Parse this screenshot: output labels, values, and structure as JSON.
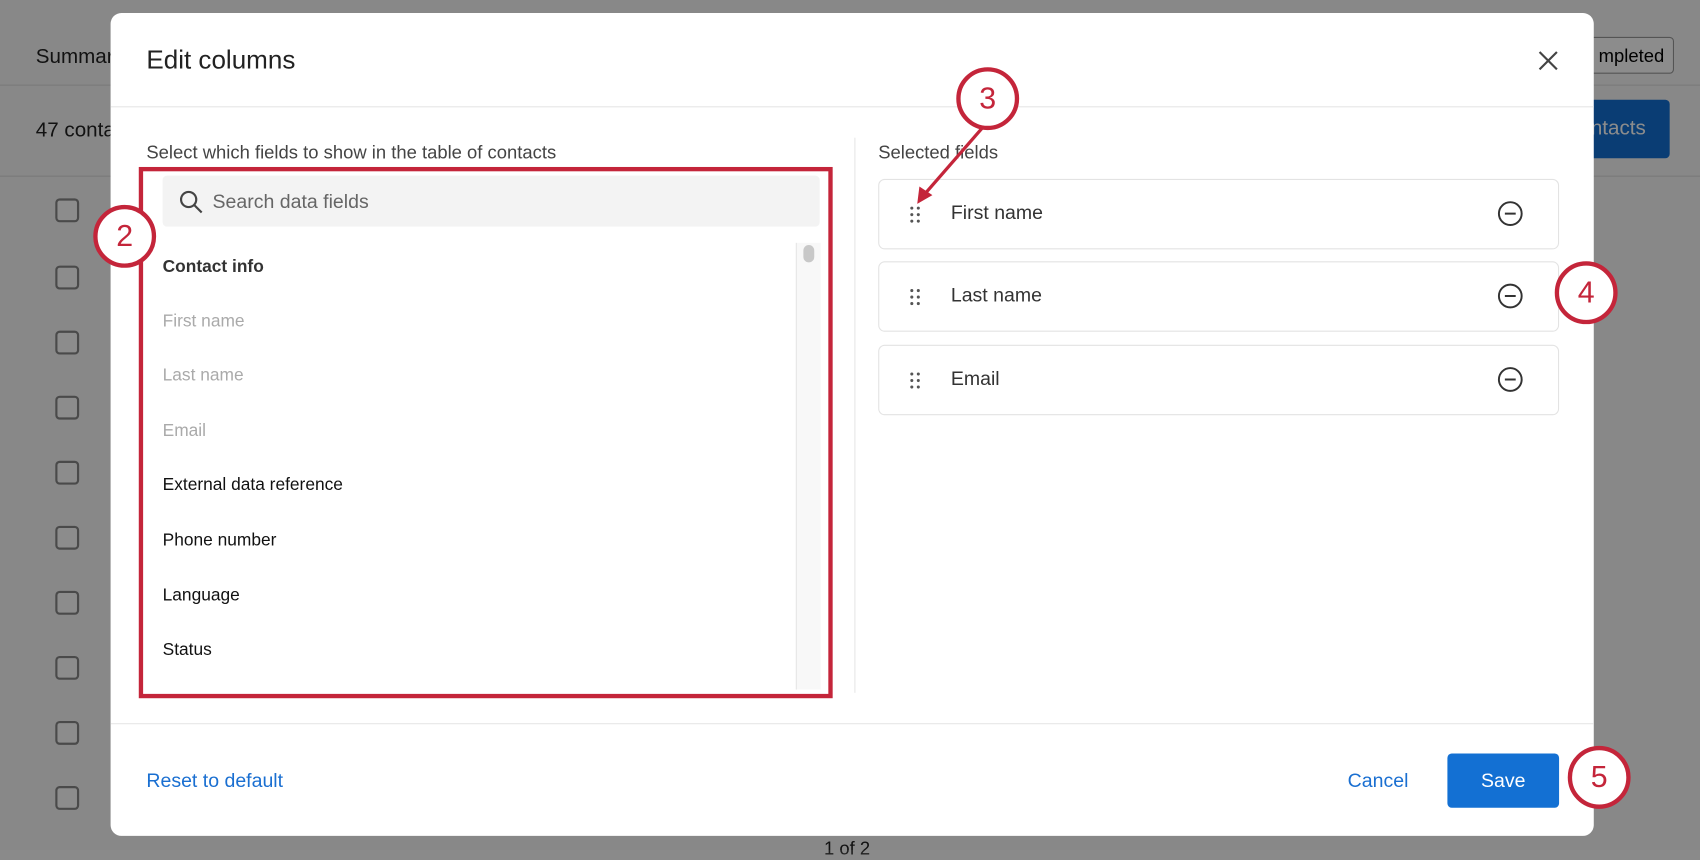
{
  "background": {
    "tab_summary": "Summar",
    "contacts_count": "47 conta",
    "completed_button": "mpleted",
    "add_contacts_button": "ntacts",
    "pagination": "1   of 2"
  },
  "modal": {
    "title": "Edit columns",
    "left_label": "Select which fields to show in the table of contacts",
    "search_placeholder": "Search data fields",
    "groups": [
      {
        "heading": "Contact info",
        "items": [
          {
            "label": "First name",
            "disabled": true
          },
          {
            "label": "Last name",
            "disabled": true
          },
          {
            "label": "Email",
            "disabled": true
          },
          {
            "label": "External data reference",
            "disabled": false
          },
          {
            "label": "Phone number",
            "disabled": false
          },
          {
            "label": "Language",
            "disabled": false
          },
          {
            "label": "Status",
            "disabled": false
          }
        ]
      }
    ],
    "right_label": "Selected fields",
    "selected": [
      {
        "label": "First name"
      },
      {
        "label": "Last name"
      },
      {
        "label": "Email"
      }
    ],
    "reset_label": "Reset to default",
    "cancel_label": "Cancel",
    "save_label": "Save"
  },
  "annotations": [
    "2",
    "3",
    "4",
    "5"
  ],
  "colors": {
    "accent": "#1370d3",
    "annotation": "#c4253a"
  }
}
